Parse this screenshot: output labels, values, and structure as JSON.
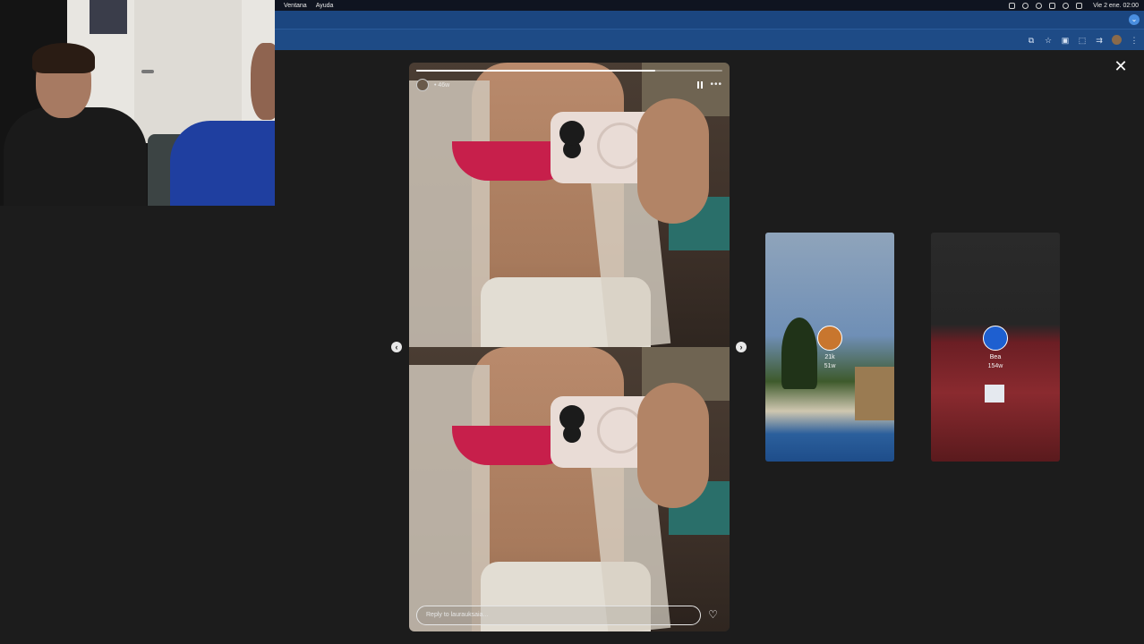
{
  "menubar": {
    "items": [
      "Ventana",
      "Ayuda"
    ],
    "clock": "Vie 2 ene. 02:00"
  },
  "toolbar": {
    "icons": [
      "screenshot-icon",
      "star-icon",
      "extension-icon",
      "puzzle-icon",
      "cast-icon",
      "profile-avatar",
      "kebab-menu-icon"
    ]
  },
  "story": {
    "time": "• 46w",
    "progress": 0.78,
    "reply_placeholder": "Reply to laurauksaia..."
  },
  "previews": [
    {
      "name": "21k",
      "time": "51w"
    },
    {
      "name": "Bea",
      "time": "154w"
    }
  ],
  "colors": {
    "background": "#1c1c1c",
    "tabstrip": "#1b4680",
    "toolbar": "#1e4b86"
  }
}
